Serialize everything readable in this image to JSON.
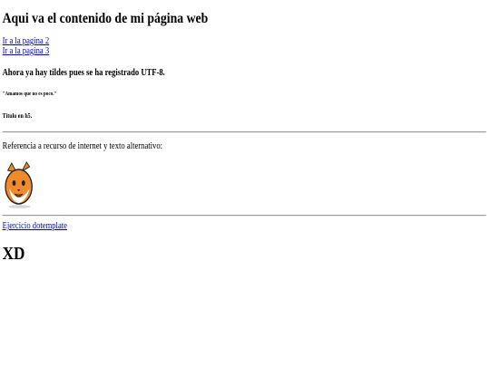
{
  "page": {
    "title": "Aqui va el contenido de mi página web",
    "links": [
      {
        "label": "Ir a la pagina 2"
      },
      {
        "label": "Ir a la pagina 3"
      }
    ],
    "h3_text": "Ahora ya hay tildes pues se ha registrado UTF-8.",
    "h6_text": "\"Amamos que no es poco.\"",
    "h5_text": "Título en h5.",
    "reference_text": "Referencia a recurso de internet y texto alternativo:",
    "image_icon": "cat-face-icon",
    "template_link": "Ejercicio dotemplate",
    "big_heading": "XD"
  }
}
